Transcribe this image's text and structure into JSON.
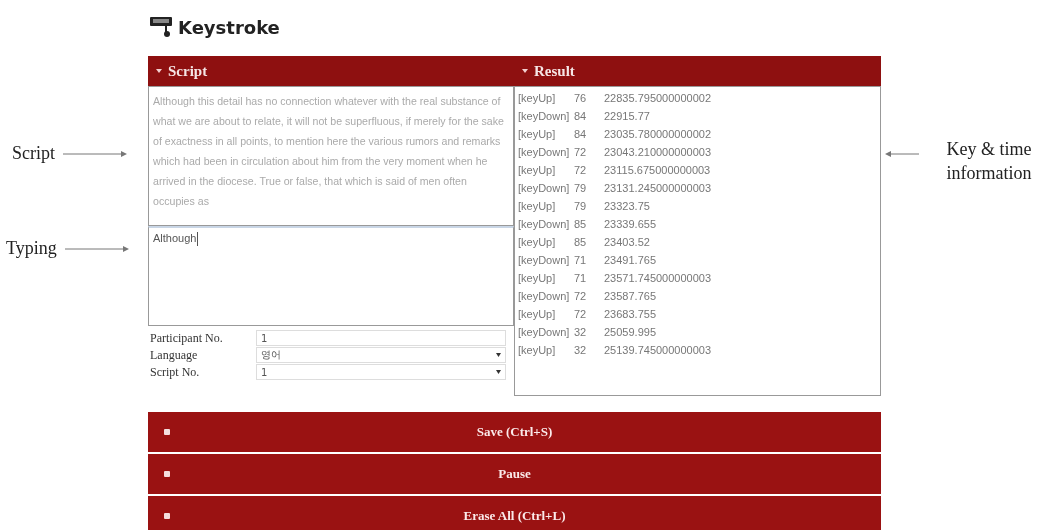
{
  "app": {
    "title": "Keystroke"
  },
  "script_panel": {
    "title": "Script",
    "text": "Although this detail has no connection whatever with the real substance of what we are about to relate, it will not be superfluous, if merely for the sake of exactness in all points, to mention here the various rumors and remarks which had been in circulation about him from the very moment when he arrived in the diocese. True or false, that which is said of men often occupies as",
    "typing": "Although "
  },
  "result_panel": {
    "title": "Result",
    "rows": [
      {
        "event": "[keyUp]",
        "key": "76",
        "time": "22835.795000000002"
      },
      {
        "event": "[keyDown]",
        "key": "84",
        "time": "22915.77"
      },
      {
        "event": "[keyUp]",
        "key": "84",
        "time": "23035.780000000002"
      },
      {
        "event": "[keyDown]",
        "key": "72",
        "time": "23043.210000000003"
      },
      {
        "event": "[keyUp]",
        "key": "72",
        "time": "23115.675000000003"
      },
      {
        "event": "[keyDown]",
        "key": "79",
        "time": "23131.245000000003"
      },
      {
        "event": "[keyUp]",
        "key": "79",
        "time": "23323.75"
      },
      {
        "event": "[keyDown]",
        "key": "85",
        "time": "23339.655"
      },
      {
        "event": "[keyUp]",
        "key": "85",
        "time": "23403.52"
      },
      {
        "event": "[keyDown]",
        "key": "71",
        "time": "23491.765"
      },
      {
        "event": "[keyUp]",
        "key": "71",
        "time": "23571.745000000003"
      },
      {
        "event": "[keyDown]",
        "key": "72",
        "time": "23587.765"
      },
      {
        "event": "[keyUp]",
        "key": "72",
        "time": "23683.755"
      },
      {
        "event": "[keyDown]",
        "key": "32",
        "time": "25059.995"
      },
      {
        "event": "[keyUp]",
        "key": "32",
        "time": "25139.745000000003"
      }
    ]
  },
  "form": [
    {
      "label": "Participant No.",
      "kind": "text",
      "value": "1"
    },
    {
      "label": "Language",
      "kind": "select",
      "value": "영어"
    },
    {
      "label": "Script No.",
      "kind": "select",
      "value": "1"
    }
  ],
  "buttons": [
    "Save (Ctrl+S)",
    "Pause",
    "Erase All (Ctrl+L)"
  ],
  "annotations": {
    "left": [
      "Script",
      "Typing"
    ],
    "right": "Key & time information"
  }
}
